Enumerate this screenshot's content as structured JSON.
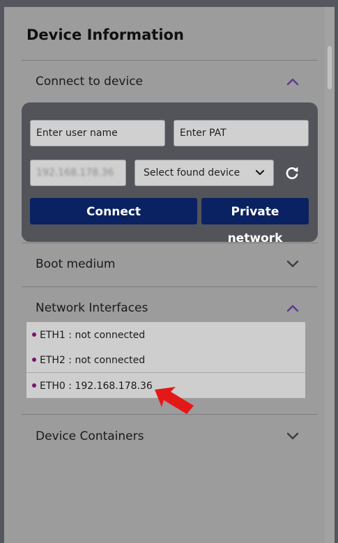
{
  "page": {
    "title": "Device Information"
  },
  "sections": {
    "connect": {
      "label": "Connect to device",
      "expanded": true,
      "user_name_placeholder": "Enter user name",
      "pat_placeholder": "Enter PAT",
      "ip_value": "192.168.178.36",
      "select_label": "Select found device",
      "connect_label": "Connect",
      "private_network_label": "Private network"
    },
    "boot": {
      "label": "Boot medium",
      "expanded": false
    },
    "network": {
      "label": "Network Interfaces",
      "expanded": true,
      "interfaces": [
        {
          "name": "ETH1",
          "status": "not connected",
          "text": "ETH1 : not connected"
        },
        {
          "name": "ETH2",
          "status": "not connected",
          "text": "ETH2 : not connected"
        },
        {
          "name": "ETH0",
          "status": "192.168.178.36",
          "text": "ETH0 : 192.168.178.36"
        }
      ]
    },
    "containers": {
      "label": "Device Containers",
      "expanded": false
    }
  },
  "icons": {
    "expand_up": "chevron-up-icon",
    "expand_down": "chevron-down-icon",
    "refresh": "refresh-icon",
    "dropdown": "chevron-down-icon",
    "annotation": "red-arrow-icon"
  },
  "colors": {
    "chevron_up": "#5a3a8e",
    "chevron_down": "#3c3c3c",
    "button_bg": "#0a2261",
    "bullet": "#7a1470",
    "arrow": "#e51818",
    "card_bg": "#52545a"
  }
}
